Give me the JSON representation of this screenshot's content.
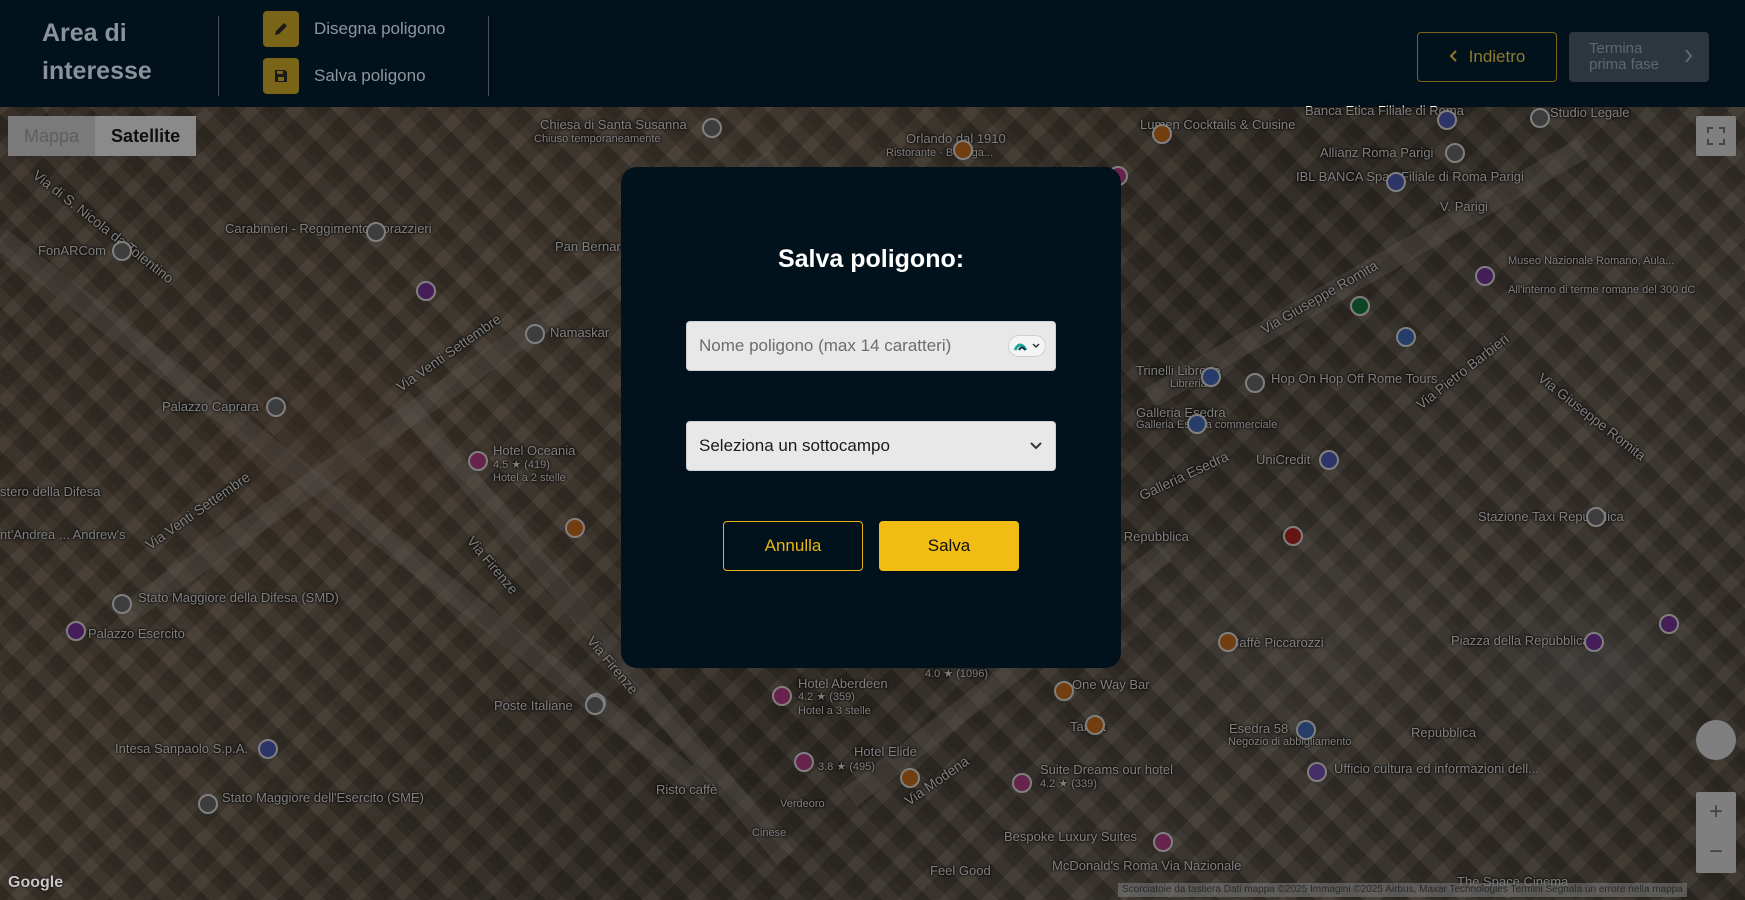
{
  "header": {
    "title": "Area di interesse",
    "tools": [
      {
        "label": "Disegna poligono",
        "icon": "pencil-icon"
      },
      {
        "label": "Salva poligono",
        "icon": "floppy-disk-icon"
      }
    ],
    "back_label": "Indietro",
    "finish_label_line1": "Termina",
    "finish_label_line2": "prima fase"
  },
  "map": {
    "type_options": [
      "Mappa",
      "Satellite"
    ],
    "selected_type": "Satellite",
    "google_logo": "Google",
    "attribution": "Scorciatoie da tastiera   Dati mappa ©2025 Immagini ©2025 Airbus, Maxar Technologies   Termini   Segnala un errore nella mappa",
    "labels": [
      "Chiesa di Santa Susanna",
      "Chiuso temporaneamente",
      "Orlando dal 1910",
      "Ristorante · Bottega...",
      "Lumen Cocktails & Cuisine",
      "Banca Etica Filiale di Roma",
      "Studio Legale",
      "Allianz Roma Parigi",
      "IBL BANCA Spa - Filiale di Roma Parigi",
      "V. Parigi",
      "Museo Nazionale Romano, Aula...",
      "All'interno di terme romane del 300 dC",
      "Carabinieri - Reggimento Corazzieri",
      "FonARCom",
      "Pan Bernardo",
      "Namaskar",
      "Palazzo Caprara",
      "Hotel Oceania",
      "4.5 ★ (419)",
      "Hotel a 2 stelle",
      "Stato Maggiore della Difesa (SMD)",
      "Palazzo Esercito",
      "Poste Italiane",
      "Intesa Sanpaolo S.p.A.",
      "Stato Maggiore dell'Esercito (SME)",
      "Hotel Aberdeen",
      "4.2 ★ (359)",
      "Hotel a 3 stelle",
      "Hotel Elide",
      "3.8 ★ (495)",
      "Risto caffè",
      "Verdeoro",
      "Cinese",
      "Feel Good",
      "One Way Bar",
      "Target",
      "Suite Dreams our hotel",
      "4.2 ★ (339)",
      "Bespoke Luxury Suites",
      "McDonald's Roma Via Nazionale",
      "Esedra 58",
      "Negozio di abbigliamento",
      "Repubblica",
      "Ufficio cultura ed informazioni dell...",
      "Caffè Piccarozzi",
      "Piazza della Repubblica",
      "Stazione Taxi Repubblica",
      "Farmacia Repubblica",
      "UniCredit",
      "Hop On Hop Off Rome Tours",
      "Galleria Esedra",
      "Galleria Esedra commerciale",
      "Trinelli Librerie",
      "Libreria",
      "The Space Cinema",
      "4.0 ★ (1096)",
      "stero della Difesa",
      "nt'Andrea ... Andrew's"
    ],
    "streets": [
      "Via di S. Nicola da Tolentino",
      "Via Venti Settembre",
      "Via Venti Settembre",
      "Via Firenze",
      "Via Firenze",
      "Via Giuseppe Romita",
      "Via Pietro Barbieri",
      "Via Giuseppe Romita",
      "Via Modena",
      "Galleria Esedra"
    ]
  },
  "modal": {
    "title": "Salva poligono:",
    "name_placeholder": "Nome poligono (max 14 caratteri)",
    "name_value": "",
    "select_value": "Seleziona un sottocampo",
    "cancel_label": "Annulla",
    "save_label": "Salva"
  },
  "colors": {
    "accent": "#f1bc14",
    "background": "#02121c",
    "input_bg": "#e8e8e8"
  }
}
